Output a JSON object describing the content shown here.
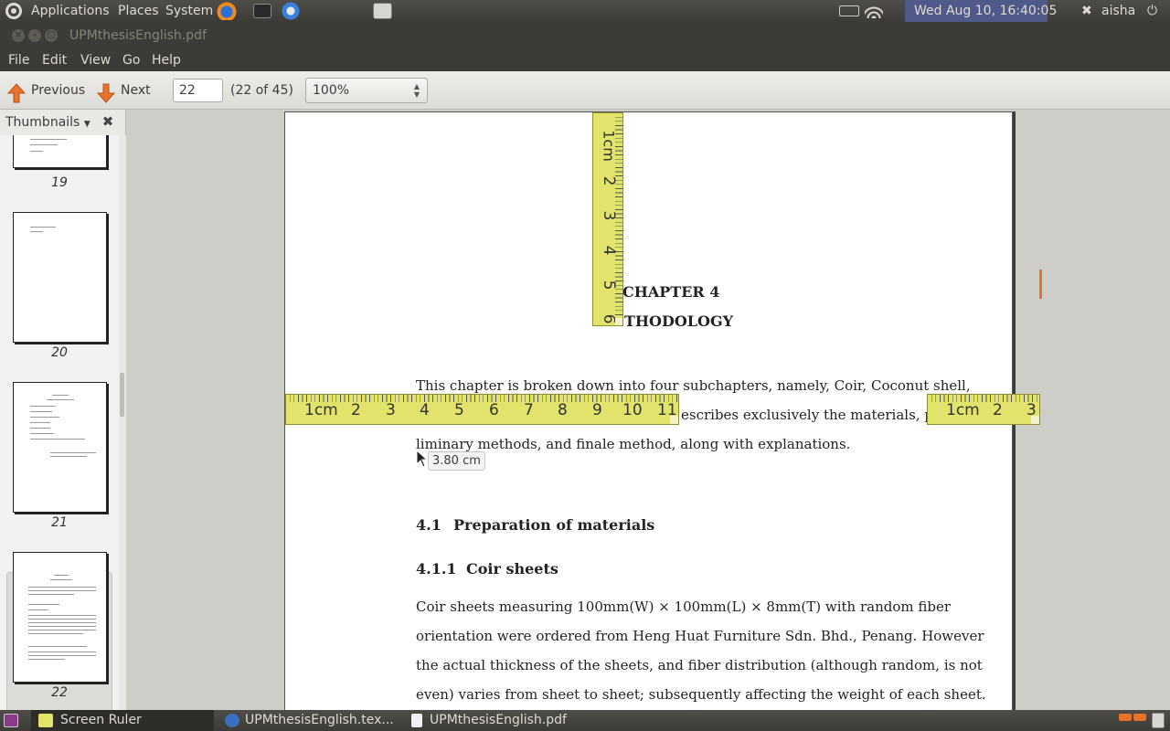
{
  "top_panel": {
    "menus": [
      "Applications",
      "Places",
      "System"
    ],
    "datetime": "Wed Aug 10, 16:40:05",
    "user": "aisha"
  },
  "window": {
    "title": "UPMthesisEnglish.pdf"
  },
  "menubar": {
    "items": [
      "File",
      "Edit",
      "View",
      "Go",
      "Help"
    ]
  },
  "toolbar": {
    "previous_label": "Previous",
    "next_label": "Next",
    "page_value": "22",
    "page_count": "(22 of 45)",
    "zoom": "100%"
  },
  "sidebar": {
    "title": "Thumbnails",
    "thumbnails": [
      {
        "label": "19"
      },
      {
        "label": "20"
      },
      {
        "label": "21"
      },
      {
        "label": "22",
        "selected": true
      }
    ]
  },
  "document": {
    "chapter_label": "CHAPTER 4",
    "chapter_title": "THODOLOGY",
    "para1_line1": "This chapter is broken down into four subchapters, namely, Coir, Coconut shell,",
    "para1_line2": "escribes exclusively the materials, pre-",
    "para1_line3": "liminary methods, and finale method, along with explanations.",
    "section_number": "4.1",
    "section_title": "Preparation of materials",
    "subsection_number": "4.1.1",
    "subsection_title": "Coir sheets",
    "para2_line1": "Coir sheets measuring 100mm(W) × 100mm(L) × 8mm(T) with random fiber",
    "para2_line2": "orientation were ordered from Heng Huat Furniture Sdn. Bhd., Penang. However",
    "para2_line3": "the actual thickness of the sheets, and fiber distribution (although random, is not",
    "para2_line4": "even) varies from sheet to sheet; subsequently affecting the weight of each sheet."
  },
  "rulers": {
    "vertical_labels": [
      "1cm",
      "2",
      "3",
      "4",
      "5",
      "6"
    ],
    "horizontal_left_labels": [
      "1cm",
      "2",
      "3",
      "4",
      "5",
      "6",
      "7",
      "8",
      "9",
      "10",
      "11"
    ],
    "horizontal_right_labels": [
      "1cm",
      "2",
      "3"
    ],
    "tooltip": "3.80 cm"
  },
  "taskbar": {
    "tasks": [
      "Screen Ruler",
      "UPMthesisEnglish.tex...",
      "UPMthesisEnglish.pdf"
    ]
  },
  "colors": {
    "panel": "#3c3b37",
    "ruler": "#e2e36a",
    "accent": "#e8722a"
  }
}
